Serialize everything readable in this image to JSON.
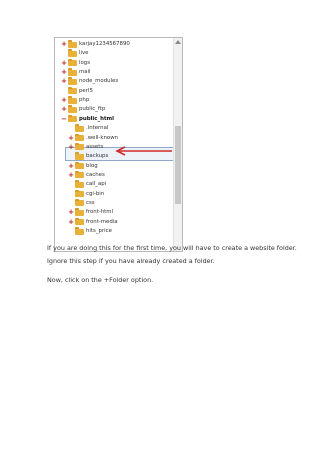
{
  "tree": {
    "items": [
      {
        "label": "karjay1234567890",
        "expander": "+",
        "level": 0
      },
      {
        "label": "live",
        "expander": "",
        "level": 0
      },
      {
        "label": "logs",
        "expander": "+",
        "level": 0
      },
      {
        "label": "mail",
        "expander": "+",
        "level": 0
      },
      {
        "label": "node_modules",
        "expander": "+",
        "level": 0
      },
      {
        "label": "perl5",
        "expander": "",
        "level": 0
      },
      {
        "label": "php",
        "expander": "+",
        "level": 0
      },
      {
        "label": "public_ftp",
        "expander": "+",
        "level": 0
      },
      {
        "label": "public_html",
        "expander": "−",
        "level": 0,
        "selected": true
      },
      {
        "label": ".internal",
        "expander": "",
        "level": 1
      },
      {
        "label": ".well-known",
        "expander": "+",
        "level": 1
      },
      {
        "label": "assets",
        "expander": "+",
        "level": 1
      },
      {
        "label": "backups",
        "expander": "",
        "level": 1
      },
      {
        "label": "blog",
        "expander": "+",
        "level": 1
      },
      {
        "label": "caches",
        "expander": "+",
        "level": 1
      },
      {
        "label": "call_api",
        "expander": "",
        "level": 1
      },
      {
        "label": "cgi-bin",
        "expander": "",
        "level": 1
      },
      {
        "label": "css",
        "expander": "",
        "level": 1
      },
      {
        "label": "front-html",
        "expander": "+",
        "level": 1
      },
      {
        "label": "front-media",
        "expander": "+",
        "level": 1
      },
      {
        "label": "hits_price",
        "expander": "",
        "level": 1
      }
    ]
  },
  "text": {
    "para1": "If you are doing this for the first time, you will have to create a website folder. Ignore this step if you have already created a folder.",
    "para2": "Now, click on the +Folder option."
  },
  "colors": {
    "folder": "#e8b23a",
    "annotation_arrow": "#d22a2a"
  },
  "icons": {
    "folder": "folder-icon",
    "expand": "expand-plus-icon",
    "collapse": "collapse-minus-icon",
    "pointer": "red-arrow-annotation"
  }
}
